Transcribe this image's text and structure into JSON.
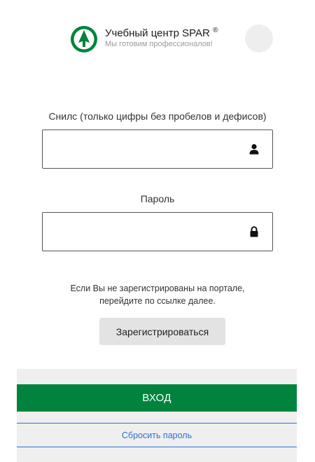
{
  "header": {
    "brand_title": "Учебный центр SPAR",
    "brand_registered": "®",
    "brand_subtitle": "Мы готовим профессионалов!",
    "logo_icon": "spar-tree-logo-icon",
    "brand_color": "#00843d"
  },
  "form": {
    "snils_label": "Снилс (только цифры без пробелов и дефисов)",
    "snils_value": "",
    "snils_icon": "user-icon",
    "password_label": "Пароль",
    "password_value": "",
    "password_icon": "lock-icon"
  },
  "register": {
    "info_line1": "Если Вы не зарегистрированы на портале,",
    "info_line2": "перейдите по ссылке далее.",
    "button_label": "Зарегистрироваться"
  },
  "actions": {
    "login_label": "ВХОД",
    "reset_label": "Сбросить пароль",
    "link_color": "#2f6fd0"
  }
}
